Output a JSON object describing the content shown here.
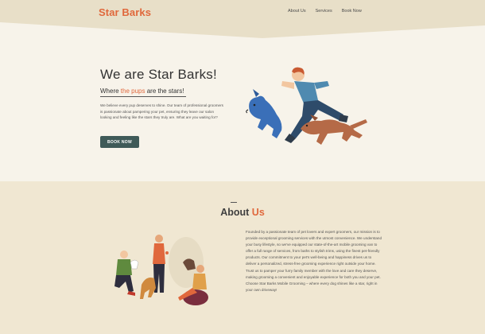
{
  "brand": {
    "name": "Star Barks"
  },
  "nav": {
    "items": [
      "About Us",
      "Services",
      "Book Now"
    ]
  },
  "hero": {
    "title": "We are Star Barks!",
    "subtitle_prefix": "Where ",
    "subtitle_accent": "the pups",
    "subtitle_suffix": " are the stars!",
    "body": "We believe every pup deserves to shine. Our team of professional groomers is passionate about pampering your pet, ensuring they leave our salon looking and feeling like the stars they truly are. What are you waiting for?",
    "cta_label": "BOOK NOW"
  },
  "about": {
    "title_prefix": "About ",
    "title_accent": "Us",
    "body": "Founded by a passionate team of pet lovers and expert groomers, our mission is to provide exceptional grooming services with the utmost convenience. We understand your busy lifestyle, so we've equipped our state-of-the-art mobile grooming van to offer a full range of services, from baths to stylish trims, using the finest pet-friendly products. Our commitment to your pet's well-being and happiness drives us to deliver a personalized, stress-free grooming experience right outside your home. Trust us to pamper your furry family member with the love and care they deserve, making grooming a convenient and enjoyable experience for both you and your pet. Choose Star Barks Mobile Grooming – where every dog shines like a star, right in your own driveway!"
  },
  "colors": {
    "accent": "#e0683c",
    "header_bg": "#e8dfc8",
    "hero_bg": "#f7f3ea",
    "about_bg": "#f0e7d2",
    "button_bg": "#3f5a58"
  },
  "icons": [
    "runner-with-dogs-illustration",
    "family-with-dogs-illustration"
  ]
}
